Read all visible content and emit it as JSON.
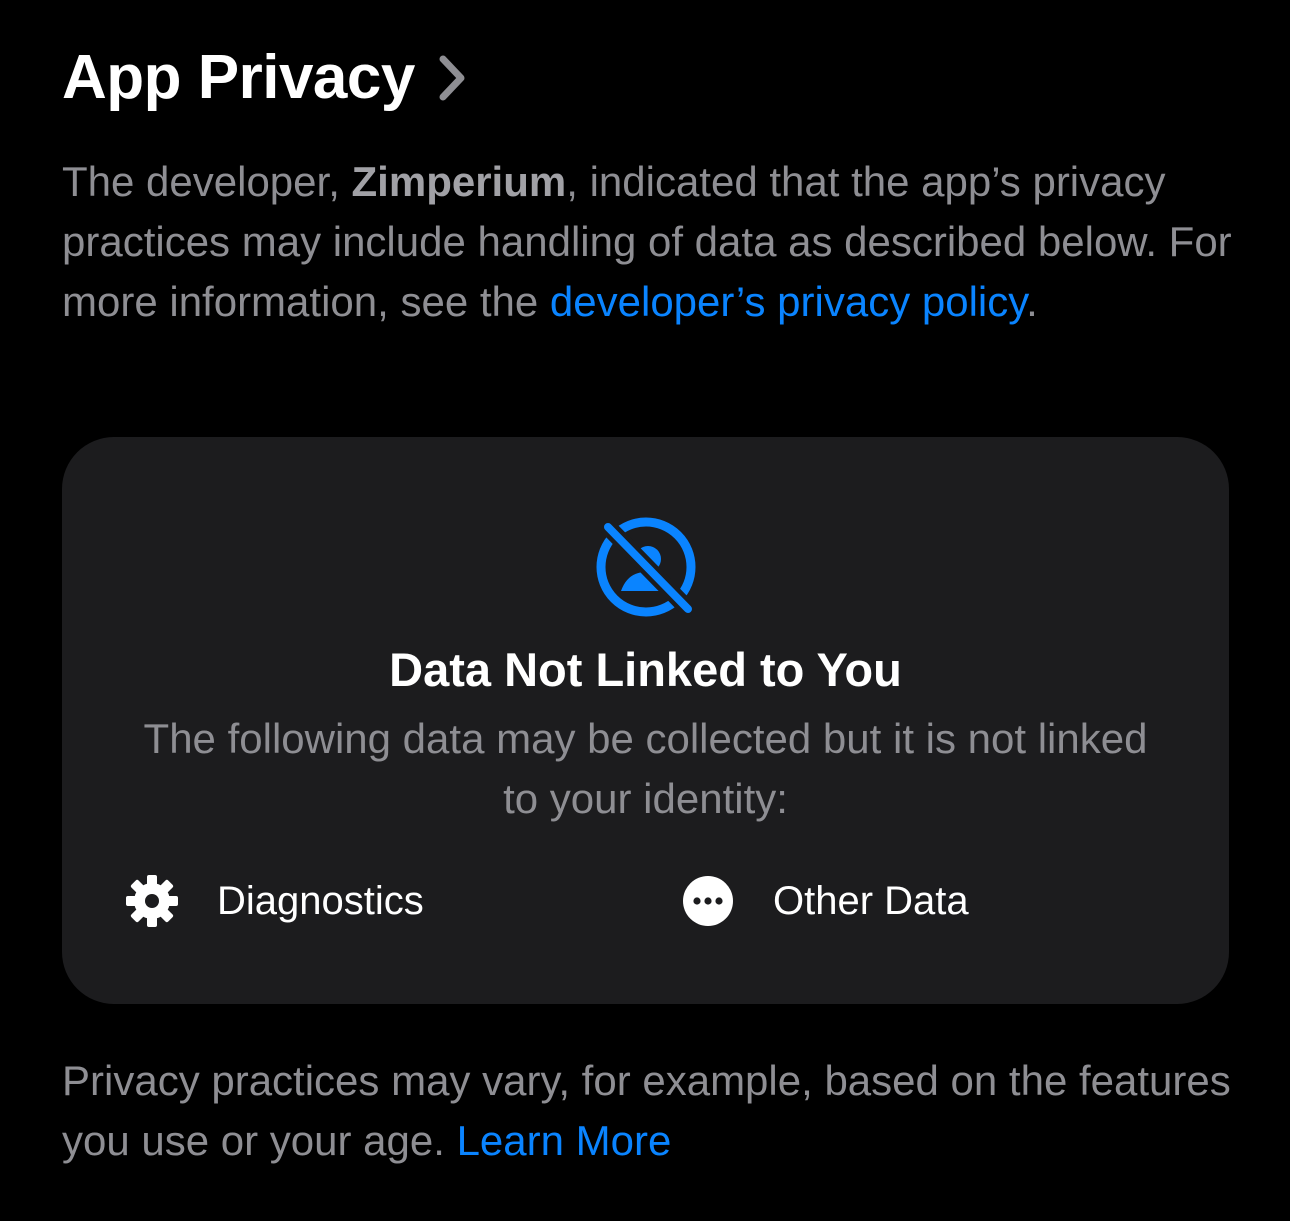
{
  "header": {
    "title": "App Privacy"
  },
  "intro": {
    "text_before": "The developer, ",
    "developer_name": "Zimperium",
    "text_after": ", indicated that the app’s privacy practices may include handling of data as described below. For more information, see the ",
    "policy_link": "developer’s privacy policy",
    "text_end": "."
  },
  "card": {
    "icon": "person-slash-circle-icon",
    "title": "Data Not Linked to You",
    "description": "The following data may be collected but it is not linked to your identity:",
    "items": [
      {
        "icon": "gear-icon",
        "label": "Diagnostics"
      },
      {
        "icon": "ellipsis-circle-icon",
        "label": "Other Data"
      }
    ]
  },
  "footer": {
    "text": "Privacy practices may vary, for example, based on the features you use or your age.",
    "learn_more": "Learn More"
  },
  "colors": {
    "background": "#000000",
    "card_background": "#1c1c1e",
    "accent": "#0a84ff",
    "secondary_text": "#8e8e93",
    "primary_text": "#ffffff"
  }
}
